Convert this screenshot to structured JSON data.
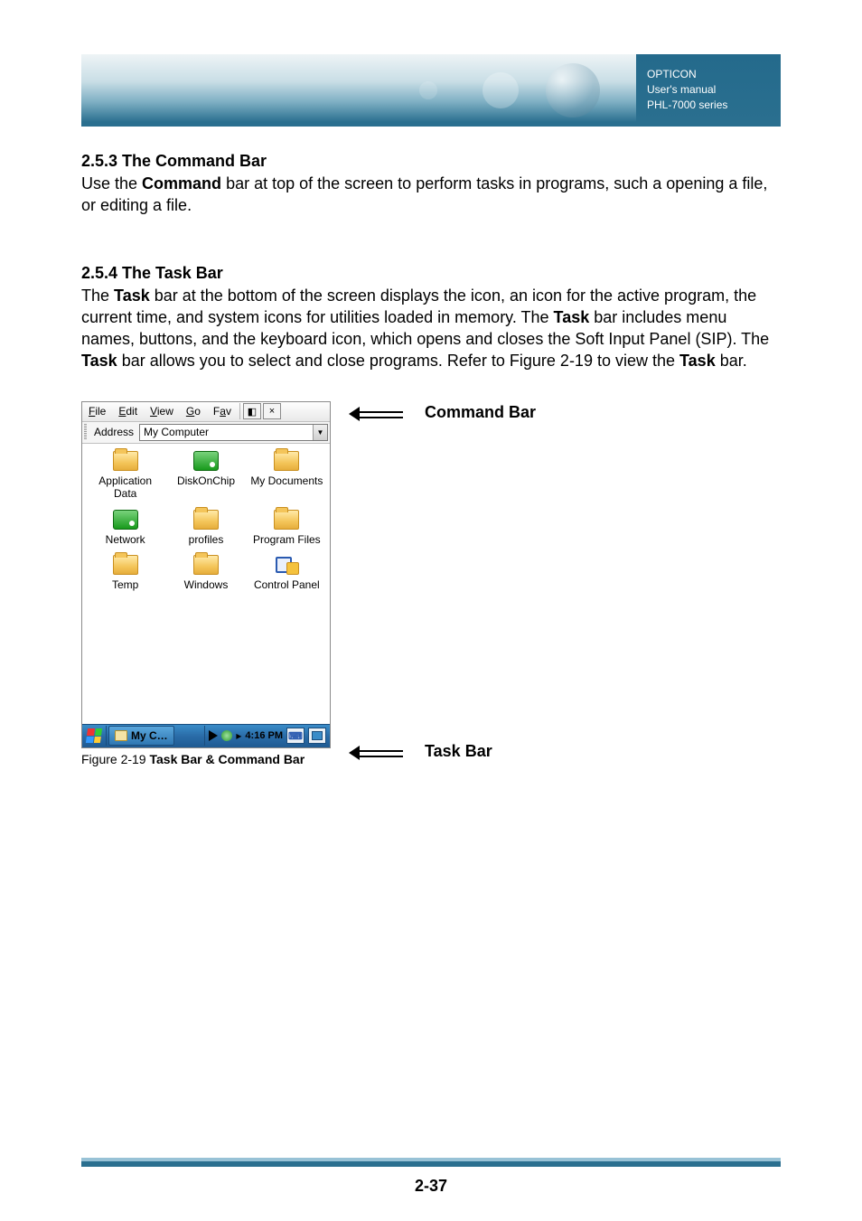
{
  "header": {
    "brand": "OPTICON",
    "line2": "User's manual",
    "line3": "PHL-7000 series"
  },
  "sections": {
    "s1": {
      "heading": "2.5.3 The Command Bar",
      "text": "Use the Command bar at top of the screen to perform tasks in programs, such a opening a file, or editing a file."
    },
    "s2": {
      "heading": "2.5.4 The Task Bar",
      "text": "The Task bar at the bottom of the screen displays the icon, an icon for the active program, the current time, and system icons for utilities loaded in memory. The Task bar includes menu names, buttons, and the keyboard icon, which opens and closes the Soft Input Panel (SIP). The Task bar allows you to select and close programs. Refer to Figure 2-19 to view the Task bar."
    }
  },
  "screenshot": {
    "menu": {
      "file": "File",
      "edit": "Edit",
      "view": "View",
      "go": "Go",
      "fav": "Fav",
      "close": "×"
    },
    "address": {
      "label": "Address",
      "value": "My Computer"
    },
    "items": [
      {
        "label": "Application Data",
        "icon": "folder"
      },
      {
        "label": "DiskOnChip",
        "icon": "drive"
      },
      {
        "label": "My Documents",
        "icon": "folder"
      },
      {
        "label": "Network",
        "icon": "drive"
      },
      {
        "label": "profiles",
        "icon": "folder"
      },
      {
        "label": "Program Files",
        "icon": "folder"
      },
      {
        "label": "Temp",
        "icon": "folder"
      },
      {
        "label": "Windows",
        "icon": "folder"
      },
      {
        "label": "Control Panel",
        "icon": "cpanel"
      }
    ],
    "taskbar": {
      "active": "My C…",
      "clock": "4:16 PM"
    }
  },
  "callouts": {
    "command": "Command Bar",
    "task": "Task Bar"
  },
  "figure_caption_prefix": "Figure 2-19 ",
  "figure_caption_bold": "Task Bar & Command Bar",
  "page_number": "2-37"
}
